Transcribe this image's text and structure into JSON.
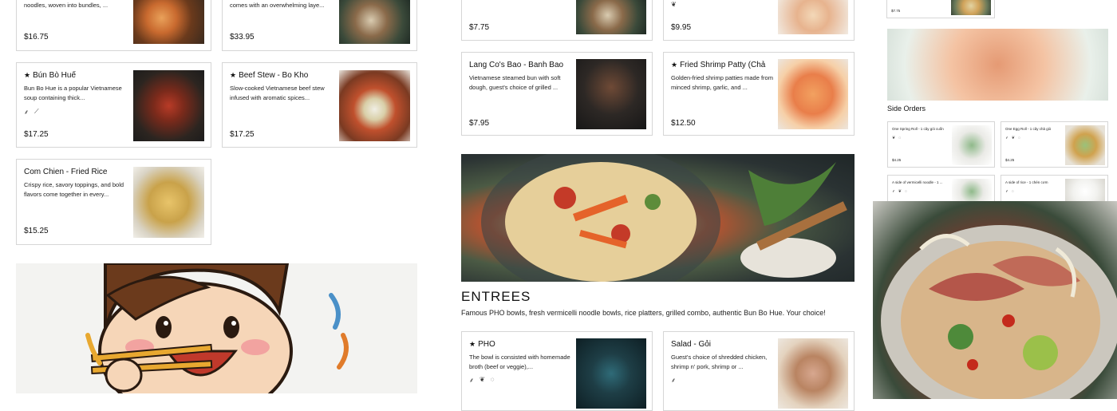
{
  "menu_items": [
    {
      "id": "top1",
      "desc": "noodles, woven into bundles, ...",
      "price": "$16.75"
    },
    {
      "id": "top2",
      "desc": "comes with an overwhelming laye...",
      "price": "$33.95"
    },
    {
      "id": "bun_bo_hue",
      "title": "Bún Bò Huế",
      "desc": "Bun Bo Hue is a popular Vietnamese soup containing thick...",
      "price": "$17.25"
    },
    {
      "id": "bo_kho",
      "title": "Beef Stew - Bo Kho",
      "desc": "Slow-cooked Vietnamese beef stew infused with aromatic spices...",
      "price": "$17.25"
    },
    {
      "id": "com_chien",
      "title": "Com Chien - Fried Rice",
      "desc": "Crispy rice, savory toppings, and bold flavors come together in every...",
      "price": "$15.25"
    },
    {
      "id": "mid_top1",
      "price": "$7.75"
    },
    {
      "id": "mid_top2",
      "price": "$9.95"
    },
    {
      "id": "banh_bao",
      "title": "Lang Co's Bao - Banh Bao",
      "desc": "Vietnamese steamed bun with soft dough, guest's choice of grilled ...",
      "price": "$7.95"
    },
    {
      "id": "cha_tom",
      "title": "Fried Shrimp Patty (Chả Tôm)",
      "desc": "Golden-fried shrimp patties made from minced shrimp, garlic, and ...",
      "price": "$12.50"
    },
    {
      "id": "pho",
      "title": "PHO",
      "desc": "The bowl is consisted with homemade broth (beef or veggie),..."
    },
    {
      "id": "goi",
      "title": "Salad - Gỏi",
      "desc": "Guest's choice of shredded chicken, shrimp n' pork, shrimp or ..."
    }
  ],
  "entrees": {
    "heading": "ENTREES",
    "subtitle": "Famous PHO bowls, fresh vermicelli noodle bowls, rice platters, grilled combo, authentic Bun Bo Hue. Your choice!"
  },
  "side_orders": {
    "heading": "Side Orders",
    "top_price": "$7.75",
    "items": [
      {
        "title": "One Spring Roll - 1 cây gỏi cuốn",
        "price": "$4.25"
      },
      {
        "title": "One Egg Roll - 1 cây chả giò",
        "price": "$4.25"
      },
      {
        "title": "A side of vermicelli noodle - 1 ...",
        "price": ""
      },
      {
        "title": "A side of rice - 1 chén cơm",
        "price": ""
      }
    ]
  },
  "icons": {
    "star": "★",
    "spicy": "pepper-icon",
    "gluten": "wheat-icon",
    "vegan": "leaf-icon",
    "info": "info-icon"
  },
  "colors": {
    "border": "#d6d6d6",
    "text": "#111111",
    "background": "#ffffff"
  }
}
